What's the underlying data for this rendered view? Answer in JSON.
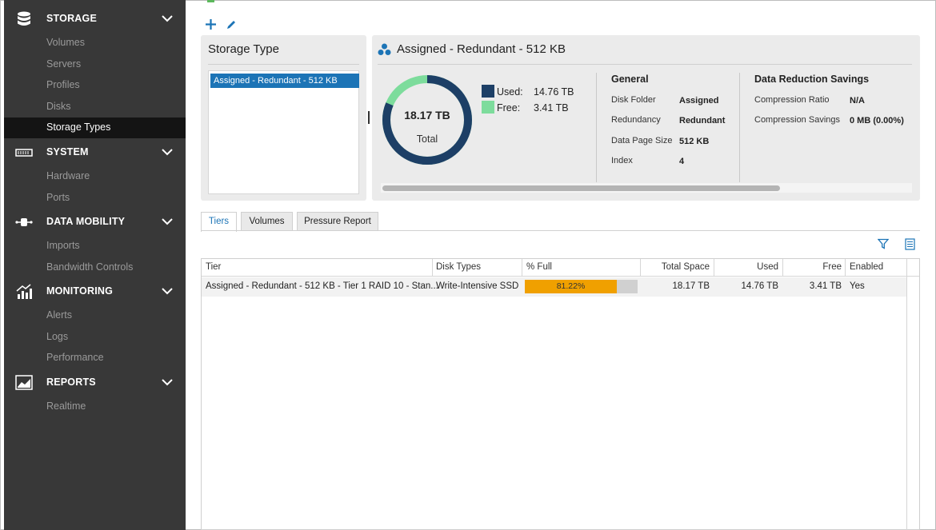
{
  "colors": {
    "sidebar_bg": "#383838",
    "sidebar_active_bg": "#141414",
    "accent": "#1c74b6",
    "used": "#1d3f66",
    "free": "#7ddc9c",
    "bar_fill": "#f0a000"
  },
  "sidebar": {
    "sections": [
      {
        "label": "STORAGE",
        "icon": "database-icon",
        "items": [
          "Volumes",
          "Servers",
          "Profiles",
          "Disks",
          "Storage Types"
        ]
      },
      {
        "label": "SYSTEM",
        "icon": "server-rack-icon",
        "items": [
          "Hardware",
          "Ports"
        ]
      },
      {
        "label": "DATA MOBILITY",
        "icon": "data-mobility-icon",
        "items": [
          "Imports",
          "Bandwidth Controls"
        ]
      },
      {
        "label": "MONITORING",
        "icon": "bar-chart-icon",
        "items": [
          "Alerts",
          "Logs",
          "Performance"
        ]
      },
      {
        "label": "REPORTS",
        "icon": "line-chart-icon",
        "items": [
          "Realtime"
        ]
      }
    ],
    "active_item": "Storage Types"
  },
  "storage_type_panel": {
    "title": "Storage Type",
    "items": [
      "Assigned - Redundant - 512 KB"
    ]
  },
  "detail": {
    "title": "Assigned - Redundant - 512 KB",
    "total_value": "18.17 TB",
    "total_label": "Total",
    "used_label": "Used:",
    "used_value": "14.76 TB",
    "free_label": "Free:",
    "free_value": "3.41 TB",
    "used_fraction": 0.8122,
    "general": {
      "heading": "General",
      "rows": [
        {
          "key": "Disk Folder",
          "value": "Assigned"
        },
        {
          "key": "Redundancy",
          "value": "Redundant"
        },
        {
          "key": "Data Page Size",
          "value": "512 KB"
        },
        {
          "key": "Index",
          "value": "4"
        }
      ]
    },
    "reduction": {
      "heading": "Data Reduction Savings",
      "rows": [
        {
          "key": "Compression Ratio",
          "value": "N/A"
        },
        {
          "key": "Compression Savings",
          "value": "0 MB (0.00%)"
        }
      ]
    }
  },
  "tabs": [
    "Tiers",
    "Volumes",
    "Pressure Report"
  ],
  "table": {
    "columns": [
      "Tier",
      "Disk Types",
      "% Full",
      "Total Space",
      "Used",
      "Free",
      "Enabled"
    ],
    "rows": [
      {
        "tier": "Assigned - Redundant - 512 KB - Tier 1 RAID 10 - Stan...",
        "disk_types": "Write-Intensive SSD",
        "pct_full": "81.22%",
        "pct_full_value": 81.22,
        "total_space": "18.17 TB",
        "used": "14.76 TB",
        "free": "3.41 TB",
        "enabled": "Yes"
      }
    ]
  }
}
